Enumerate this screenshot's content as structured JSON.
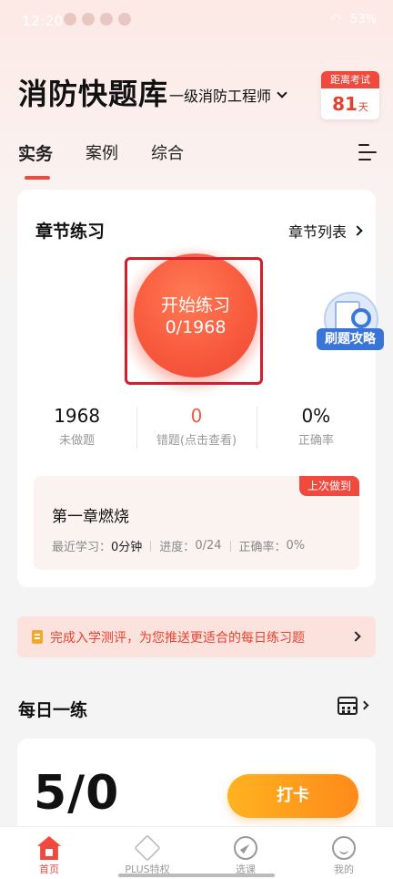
{
  "status_bar": {
    "time": "12:20",
    "battery": "53%"
  },
  "header": {
    "app_title": "消防快题库",
    "exam_select": "一级消防工程师",
    "countdown_label": "距离考试",
    "countdown_days": "81",
    "countdown_unit": "天"
  },
  "tabs": [
    {
      "label": "实务",
      "active": true
    },
    {
      "label": "案例",
      "active": false
    },
    {
      "label": "综合",
      "active": false
    }
  ],
  "chapter_practice": {
    "title": "章节练习",
    "list_link": "章节列表",
    "start_label": "开始练习",
    "start_count": "0/1968",
    "strategy_badge": "刷题攻略",
    "stats": [
      {
        "value": "1968",
        "label": "未做题"
      },
      {
        "value": "0",
        "label": "错题(点击查看)"
      },
      {
        "value": "0%",
        "label": "正确率"
      }
    ],
    "last": {
      "tag": "上次做到",
      "chapter": "第一章燃烧",
      "recent_label": "最近学习：",
      "recent_value": "0分钟",
      "progress_label": "进度：",
      "progress_value": "0/24",
      "accuracy_label": "正确率：",
      "accuracy_value": "0%"
    }
  },
  "banner": {
    "text": "完成入学测评，为您推送更适合的每日练习题"
  },
  "daily": {
    "title": "每日一练",
    "score": "5/0",
    "checkin": "打卡"
  },
  "bottom_nav": [
    {
      "label": "首页",
      "icon": "home-icon",
      "active": true
    },
    {
      "label": "PLUS特权",
      "icon": "diamond-icon",
      "active": false
    },
    {
      "label": "选课",
      "icon": "compass-icon",
      "active": false
    },
    {
      "label": "我的",
      "icon": "profile-icon",
      "active": false
    }
  ],
  "colors": {
    "accent": "#f04a3e",
    "checkin_orange": "#ffa01e",
    "strategy_blue": "#3a74d6"
  }
}
